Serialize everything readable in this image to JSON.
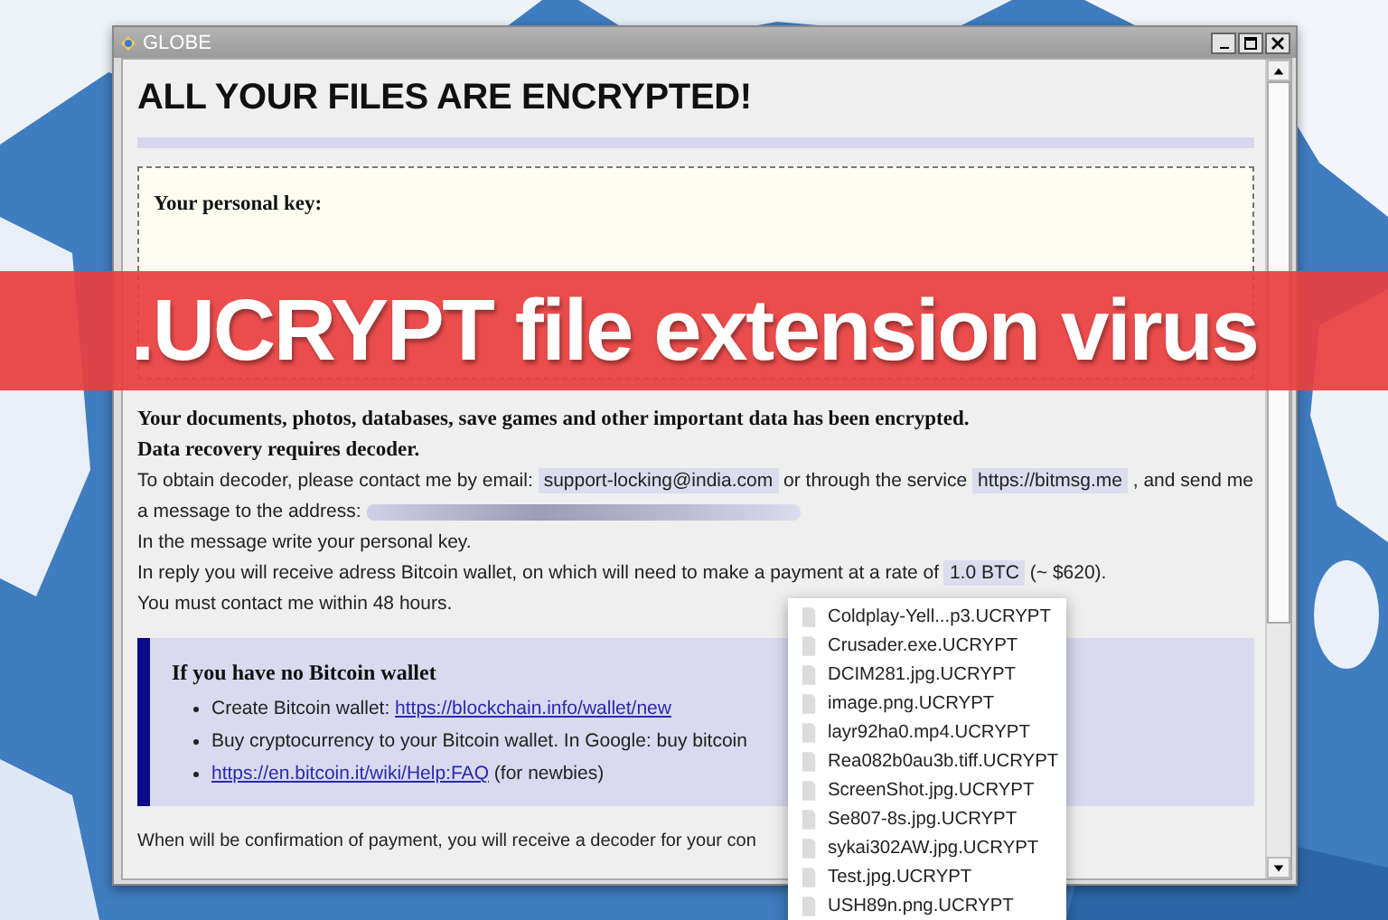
{
  "window": {
    "title": "GLOBE",
    "heading": "ALL YOUR FILES ARE ENCRYPTED!",
    "key_label": "Your personal key:",
    "message": [
      {
        "kind": "bold",
        "segments": [
          {
            "kind": "plain",
            "text": "Your documents, photos, databases, save games and other important data has been encrypted."
          }
        ]
      },
      {
        "kind": "bold",
        "segments": [
          {
            "kind": "plain",
            "text": "Data recovery requires decoder."
          }
        ]
      },
      {
        "kind": "normal",
        "segments": [
          {
            "kind": "plain",
            "text": "To obtain decoder, please contact me by email: "
          },
          {
            "kind": "highlight",
            "text": "support-locking@india.com"
          },
          {
            "kind": "plain",
            "text": " or through the service "
          },
          {
            "kind": "highlight",
            "text": "https://bitmsg.me"
          },
          {
            "kind": "plain",
            "text": " , and send me a message to the address: "
          },
          {
            "kind": "redacted"
          }
        ]
      },
      {
        "kind": "normal",
        "segments": [
          {
            "kind": "plain",
            "text": "In the message write your personal key."
          }
        ]
      },
      {
        "kind": "normal",
        "segments": [
          {
            "kind": "plain",
            "text": "In reply you will receive adress Bitcoin wallet, on which will need to make a payment at a rate of "
          },
          {
            "kind": "highlight",
            "text": "1.0 BTC"
          },
          {
            "kind": "plain",
            "text": " (~ $620)."
          }
        ]
      },
      {
        "kind": "normal",
        "segments": [
          {
            "kind": "plain",
            "text": "You must contact me within 48 hours."
          }
        ]
      }
    ],
    "wallet_box": {
      "heading": "If you have no Bitcoin wallet",
      "items": [
        [
          {
            "kind": "plain",
            "text": "Create Bitcoin wallet: "
          },
          {
            "kind": "link",
            "text": "https://blockchain.info/wallet/new"
          }
        ],
        [
          {
            "kind": "plain",
            "text": "Buy cryptocurrency to your Bitcoin wallet. In Google: buy bitcoin"
          }
        ],
        [
          {
            "kind": "link",
            "text": "https://en.bitcoin.it/wiki/Help:FAQ"
          },
          {
            "kind": "plain",
            "text": " (for newbies)"
          }
        ]
      ]
    },
    "footer": "When will be confirmation of payment, you will receive a decoder for your con"
  },
  "banner": ".UCRYPT file extension virus",
  "file_list": [
    "Coldplay-Yell...p3.UCRYPT",
    "Crusader.exe.UCRYPT",
    "DCIM281.jpg.UCRYPT",
    "image.png.UCRYPT",
    "layr92ha0.mp4.UCRYPT",
    "Rea082b0au3b.tiff.UCRYPT",
    "ScreenShot.jpg.UCRYPT",
    "Se807-8s.jpg.UCRYPT",
    "sykai302AW.jpg.UCRYPT",
    "Test.jpg.UCRYPT",
    "USH89n.png.UCRYPT"
  ]
}
